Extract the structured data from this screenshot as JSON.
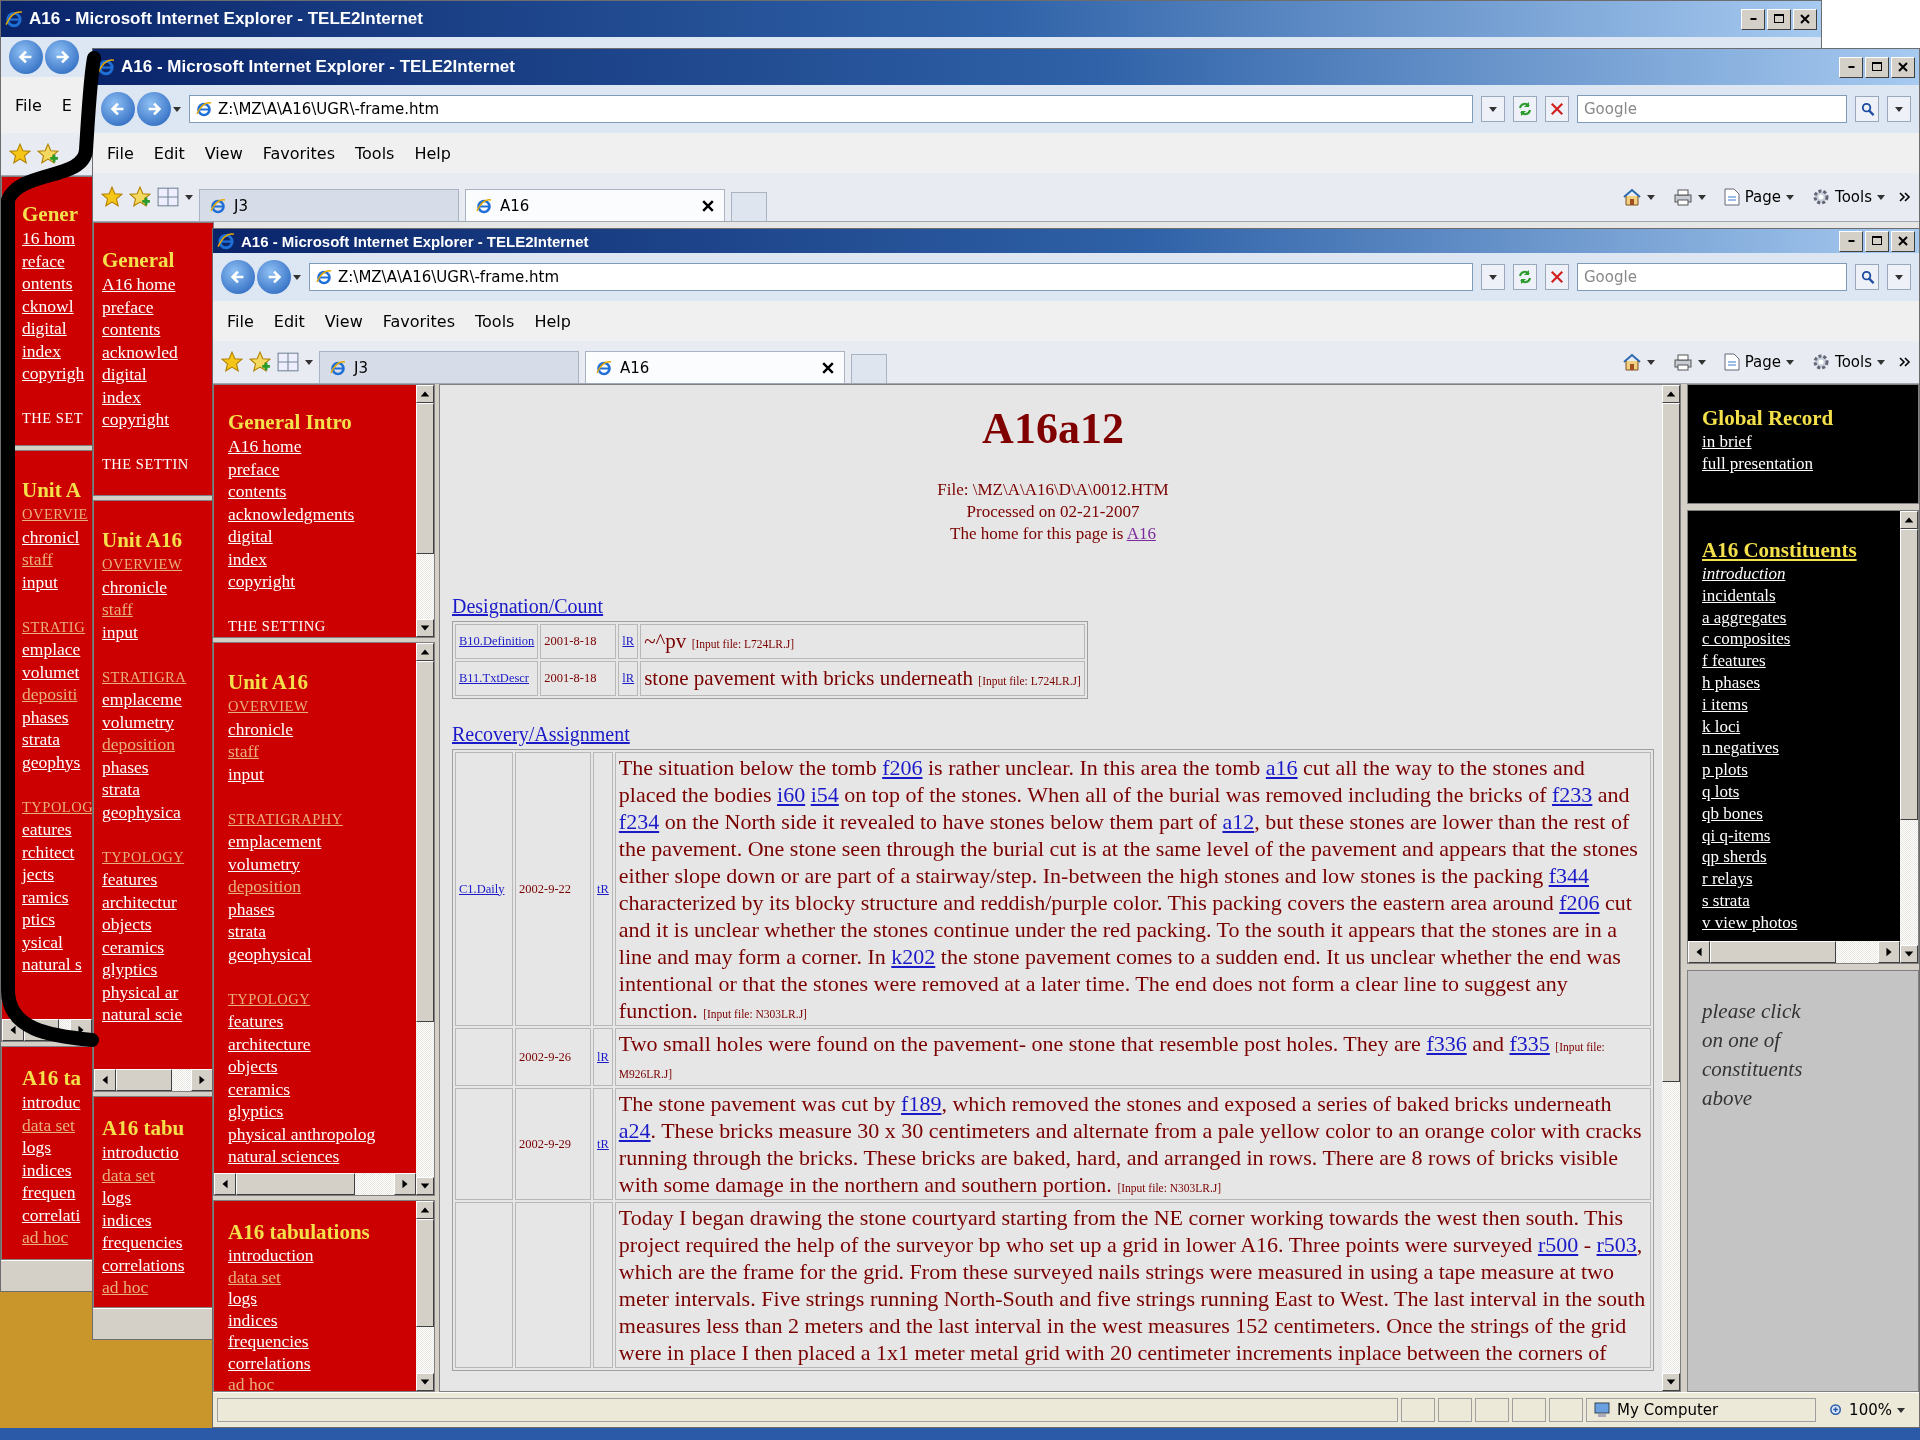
{
  "windows": [
    {
      "title": "A16 - Microsoft Internet Explorer - TELE2Internet",
      "menu": [
        "File",
        "E"
      ],
      "sidebar": [
        {
          "heading": "Gener",
          "items": [
            {
              "kind": "link",
              "text": "16 hom",
              "visited": false
            },
            {
              "kind": "link",
              "text": "reface",
              "visited": false
            },
            {
              "kind": "link",
              "text": "ontents",
              "visited": false
            },
            {
              "kind": "link",
              "text": "cknowl",
              "visited": false
            },
            {
              "kind": "link",
              "text": "digital",
              "visited": false
            },
            {
              "kind": "link",
              "text": "index",
              "visited": false
            },
            {
              "kind": "link",
              "text": "copyrigh",
              "visited": false
            },
            {
              "kind": "section",
              "text": "THE SET",
              "visited": false
            }
          ]
        },
        {
          "heading": "Unit A",
          "items": [
            {
              "kind": "section",
              "text": "OVERVIE",
              "visited": true
            },
            {
              "kind": "link",
              "text": "chronicl",
              "visited": false
            },
            {
              "kind": "link",
              "text": "staff",
              "visited": true
            },
            {
              "kind": "link",
              "text": "input",
              "visited": false
            },
            {
              "kind": "section",
              "text": "STRATIG",
              "visited": true
            },
            {
              "kind": "link",
              "text": "emplace",
              "visited": false
            },
            {
              "kind": "link",
              "text": "volumet",
              "visited": false
            },
            {
              "kind": "link",
              "text": "depositi",
              "visited": true
            },
            {
              "kind": "link",
              "text": "phases",
              "visited": false
            },
            {
              "kind": "link",
              "text": "strata",
              "visited": false
            },
            {
              "kind": "link",
              "text": "geophys",
              "visited": false
            },
            {
              "kind": "section",
              "text": "TYPOLOG",
              "visited": true
            },
            {
              "kind": "link",
              "text": "eatures",
              "visited": false
            },
            {
              "kind": "link",
              "text": "rchitect",
              "visited": false
            },
            {
              "kind": "link",
              "text": "jects",
              "visited": false
            },
            {
              "kind": "link",
              "text": "ramics",
              "visited": false
            },
            {
              "kind": "link",
              "text": "ptics",
              "visited": false
            },
            {
              "kind": "link",
              "text": "ysical",
              "visited": false
            },
            {
              "kind": "link",
              "text": "natural s",
              "visited": false
            }
          ]
        },
        {
          "heading": "A16 ta",
          "items": [
            {
              "kind": "link",
              "text": "introduc",
              "visited": false
            },
            {
              "kind": "link",
              "text": "data set",
              "visited": true
            },
            {
              "kind": "link",
              "text": "logs",
              "visited": false
            },
            {
              "kind": "link",
              "text": "indices",
              "visited": false
            },
            {
              "kind": "link",
              "text": "frequen",
              "visited": false
            },
            {
              "kind": "link",
              "text": "correlati",
              "visited": false
            },
            {
              "kind": "link",
              "text": "ad hoc",
              "visited": true
            }
          ]
        }
      ]
    },
    {
      "title": "A16 - Microsoft Internet Explorer - TELE2Internet",
      "address": "Z:\\MZ\\A\\A16\\UGR\\-frame.htm",
      "search_placeholder": "Google",
      "menu": [
        "File",
        "Edit",
        "View",
        "Favorites",
        "Tools",
        "Help"
      ],
      "tabs": [
        {
          "label": "J3",
          "selected": false
        },
        {
          "label": "A16",
          "selected": true
        }
      ],
      "toolbar": [
        "Page",
        "Tools"
      ],
      "sidebar": [
        {
          "heading": "General",
          "items": [
            {
              "kind": "link",
              "text": "A16 home",
              "visited": false
            },
            {
              "kind": "link",
              "text": "preface",
              "visited": false
            },
            {
              "kind": "link",
              "text": "contents",
              "visited": false
            },
            {
              "kind": "link",
              "text": "acknowled",
              "visited": false
            },
            {
              "kind": "link",
              "text": "digital",
              "visited": false
            },
            {
              "kind": "link",
              "text": "index",
              "visited": false
            },
            {
              "kind": "link",
              "text": "copyright",
              "visited": false
            },
            {
              "kind": "section",
              "text": "THE SETTIN",
              "visited": false
            }
          ]
        },
        {
          "heading": "Unit A16",
          "items": [
            {
              "kind": "section",
              "text": "OVERVIEW",
              "visited": true
            },
            {
              "kind": "link",
              "text": "chronicle",
              "visited": false
            },
            {
              "kind": "link",
              "text": "staff",
              "visited": true
            },
            {
              "kind": "link",
              "text": "input",
              "visited": false
            },
            {
              "kind": "section",
              "text": "STRATIGRA",
              "visited": true
            },
            {
              "kind": "link",
              "text": "emplaceme",
              "visited": false
            },
            {
              "kind": "link",
              "text": "volumetry",
              "visited": false
            },
            {
              "kind": "link",
              "text": "deposition",
              "visited": true
            },
            {
              "kind": "link",
              "text": "phases",
              "visited": false
            },
            {
              "kind": "link",
              "text": "strata",
              "visited": false
            },
            {
              "kind": "link",
              "text": "geophysica",
              "visited": false
            },
            {
              "kind": "section",
              "text": "TYPOLOGY",
              "visited": true
            },
            {
              "kind": "link",
              "text": "features",
              "visited": false
            },
            {
              "kind": "link",
              "text": "architectur",
              "visited": false
            },
            {
              "kind": "link",
              "text": "objects",
              "visited": false
            },
            {
              "kind": "link",
              "text": "ceramics",
              "visited": false
            },
            {
              "kind": "link",
              "text": "glyptics",
              "visited": false
            },
            {
              "kind": "link",
              "text": "physical ar",
              "visited": false
            },
            {
              "kind": "link",
              "text": "natural scie",
              "visited": false
            }
          ]
        },
        {
          "heading": "A16 tabu",
          "items": [
            {
              "kind": "link",
              "text": "introductio",
              "visited": false
            },
            {
              "kind": "link",
              "text": "data set",
              "visited": true
            },
            {
              "kind": "link",
              "text": "logs",
              "visited": false
            },
            {
              "kind": "link",
              "text": "indices",
              "visited": false
            },
            {
              "kind": "link",
              "text": "frequencies",
              "visited": false
            },
            {
              "kind": "link",
              "text": "correlations",
              "visited": false
            },
            {
              "kind": "link",
              "text": "ad hoc",
              "visited": true
            }
          ]
        }
      ]
    },
    {
      "title": "A16 - Microsoft Internet Explorer - TELE2Internet",
      "address": "Z:\\MZ\\A\\A16\\UGR\\-frame.htm",
      "search_placeholder": "Google",
      "menu": [
        "File",
        "Edit",
        "View",
        "Favorites",
        "Tools",
        "Help"
      ],
      "tabs": [
        {
          "label": "J3",
          "selected": false
        },
        {
          "label": "A16",
          "selected": true
        }
      ],
      "toolbar": [
        "Page",
        "Tools"
      ],
      "sidebar": [
        {
          "heading": "General Intro",
          "items": [
            {
              "kind": "link",
              "text": "A16 home",
              "visited": false
            },
            {
              "kind": "link",
              "text": "preface",
              "visited": false
            },
            {
              "kind": "link",
              "text": "contents",
              "visited": false
            },
            {
              "kind": "link",
              "text": "acknowledgments",
              "visited": false
            },
            {
              "kind": "link",
              "text": "digital",
              "visited": false
            },
            {
              "kind": "link",
              "text": "index",
              "visited": false
            },
            {
              "kind": "link",
              "text": "copyright",
              "visited": false
            },
            {
              "kind": "section",
              "text": "THE SETTING",
              "visited": false
            }
          ]
        },
        {
          "heading": "Unit A16",
          "items": [
            {
              "kind": "section",
              "text": "OVERVIEW",
              "visited": true
            },
            {
              "kind": "link",
              "text": "chronicle",
              "visited": false
            },
            {
              "kind": "link",
              "text": "staff",
              "visited": true
            },
            {
              "kind": "link",
              "text": "input",
              "visited": false
            },
            {
              "kind": "section",
              "text": "STRATIGRAPHY",
              "visited": true
            },
            {
              "kind": "link",
              "text": "emplacement",
              "visited": false
            },
            {
              "kind": "link",
              "text": "volumetry",
              "visited": false
            },
            {
              "kind": "link",
              "text": "deposition",
              "visited": true
            },
            {
              "kind": "link",
              "text": "phases",
              "visited": false
            },
            {
              "kind": "link",
              "text": "strata",
              "visited": false
            },
            {
              "kind": "link",
              "text": "geophysical",
              "visited": false
            },
            {
              "kind": "section",
              "text": "TYPOLOGY",
              "visited": true
            },
            {
              "kind": "link",
              "text": "features",
              "visited": false
            },
            {
              "kind": "link",
              "text": "architecture",
              "visited": false
            },
            {
              "kind": "link",
              "text": "objects",
              "visited": false
            },
            {
              "kind": "link",
              "text": "ceramics",
              "visited": false
            },
            {
              "kind": "link",
              "text": "glyptics",
              "visited": false
            },
            {
              "kind": "link",
              "text": "physical anthropolog",
              "visited": false
            },
            {
              "kind": "link",
              "text": "natural sciences",
              "visited": false
            }
          ]
        },
        {
          "heading": "A16 tabulations",
          "items": [
            {
              "kind": "link",
              "text": "introduction",
              "visited": false
            },
            {
              "kind": "link",
              "text": "data set",
              "visited": true
            },
            {
              "kind": "link",
              "text": "logs",
              "visited": false
            },
            {
              "kind": "link",
              "text": "indices",
              "visited": false
            },
            {
              "kind": "link",
              "text": "frequencies",
              "visited": false
            },
            {
              "kind": "link",
              "text": "correlations",
              "visited": false
            },
            {
              "kind": "link",
              "text": "ad hoc",
              "visited": true
            }
          ]
        }
      ],
      "page": {
        "title": "A16a12",
        "file_line": "File: \\MZ\\A\\A16\\D\\A\\0012.HTM",
        "processed_line": "Processed on 02-21-2007",
        "home_prefix": "The home for this page is ",
        "home_link": "A16",
        "sections": [
          {
            "heading": "Designation/Count",
            "rows": [
              {
                "code": "B10.Definition",
                "date": "2001-8-18",
                "ref": "lR",
                "parts": [
                  {
                    "kind": "text",
                    "text": "~^pv "
                  },
                  {
                    "kind": "note",
                    "text": "[Input file: L724LR.J]"
                  }
                ]
              },
              {
                "code": "B11.TxtDescr",
                "date": "2001-8-18",
                "ref": "lR",
                "parts": [
                  {
                    "kind": "text",
                    "text": "stone pavement with bricks underneath "
                  },
                  {
                    "kind": "note",
                    "text": "[Input file: L724LR.J]"
                  }
                ]
              }
            ]
          },
          {
            "heading": "Recovery/Assignment",
            "rows": [
              {
                "code": "C1.Daily",
                "date": "2002-9-22",
                "ref": "tR",
                "parts": [
                  {
                    "kind": "text",
                    "text": "The situation below the tomb "
                  },
                  {
                    "kind": "link",
                    "text": "f206"
                  },
                  {
                    "kind": "text",
                    "text": " is rather unclear. In this area the tomb "
                  },
                  {
                    "kind": "link",
                    "text": "a16"
                  },
                  {
                    "kind": "text",
                    "text": " cut all the way to the stones and placed the bodies "
                  },
                  {
                    "kind": "link",
                    "text": "i60"
                  },
                  {
                    "kind": "link",
                    "text": "i54"
                  },
                  {
                    "kind": "text",
                    "text": " on top of the stones. When all of the burial was removed including the bricks of "
                  },
                  {
                    "kind": "link",
                    "text": "f233"
                  },
                  {
                    "kind": "text",
                    "text": " and "
                  },
                  {
                    "kind": "link",
                    "text": "f234"
                  },
                  {
                    "kind": "text",
                    "text": " on the North side it revealed to have stones below them part of "
                  },
                  {
                    "kind": "link",
                    "text": "a12"
                  },
                  {
                    "kind": "text",
                    "text": ", but these stones are lower than the rest of the pavement. One stone seen through the burial cut is at the same level of the pavement and appears that the stones either slope down or are part of a stairway/step. In-between the high stones and low stones is the packing "
                  },
                  {
                    "kind": "link",
                    "text": "f344"
                  },
                  {
                    "kind": "text",
                    "text": " characterized by its blocky structure and reddish/purple color. This packing covers the eastern area around "
                  },
                  {
                    "kind": "link",
                    "text": "f206"
                  },
                  {
                    "kind": "text",
                    "text": " cut and it is unclear whether the stones continue under the red packing. To the south it appears that the stones are in a line and may form a corner. In "
                  },
                  {
                    "kind": "link",
                    "text": "k202"
                  },
                  {
                    "kind": "text",
                    "text": " the stone pavement comes to a sudden end. It us unclear whether the end was intentional or that the stones were removed at a later time. The end does not form a clear line to suggest any function. "
                  },
                  {
                    "kind": "note",
                    "text": "[Input file: N303LR.J]"
                  }
                ]
              },
              {
                "date": "2002-9-26",
                "ref": "lR",
                "parts": [
                  {
                    "kind": "text",
                    "text": "Two small holes were found on the pavement- one stone that resemble post holes. They are "
                  },
                  {
                    "kind": "link",
                    "text": "f336"
                  },
                  {
                    "kind": "text",
                    "text": " and "
                  },
                  {
                    "kind": "link",
                    "text": "f335"
                  },
                  {
                    "kind": "note",
                    "text": "[Input file: M926LR.J]"
                  }
                ]
              },
              {
                "date": "2002-9-29",
                "ref": "tR",
                "parts": [
                  {
                    "kind": "text",
                    "text": "The stone pavement was cut by "
                  },
                  {
                    "kind": "link",
                    "text": "f189"
                  },
                  {
                    "kind": "text",
                    "text": ", which removed the stones and exposed a series of baked bricks underneath "
                  },
                  {
                    "kind": "link",
                    "text": "a24"
                  },
                  {
                    "kind": "text",
                    "text": ". These bricks measure 30 x 30 centimeters and alternate from a pale yellow color to an orange color with cracks running through the bricks. These bricks are baked, hard, and arranged in rows. There are 8 rows of bricks visible with some damage in the northern and southern portion. "
                  },
                  {
                    "kind": "note",
                    "text": "[Input file: N303LR.J]"
                  }
                ]
              },
              {
                "parts": [
                  {
                    "kind": "text",
                    "text": "Today I began drawing the stone courtyard starting from the NE corner working towards the west then south. This project required the help of the surveyor bp who set up a grid in lower A16. Three points were surveyed "
                  },
                  {
                    "kind": "link",
                    "text": "r500"
                  },
                  {
                    "kind": "text",
                    "text": " - "
                  },
                  {
                    "kind": "link",
                    "text": "r503"
                  },
                  {
                    "kind": "text",
                    "text": ", which are the frame for the grid. From these surveyed nails strings were measured in using a tape measure at two meter intervals. Five strings running North-South and five strings running East to West. The last interval in the south measures less than 2 meters and the last interval in the west measures 152 centimeters. Once the strings of the grid were in place I then placed a 1x1 meter metal grid with 20 centimeter increments inplace between the corners of"
                  }
                ]
              }
            ]
          }
        ]
      },
      "right_frame": {
        "global_heading": "Global Record",
        "global_links": [
          "in brief",
          "full presentation"
        ],
        "constituents_heading": "A16 Constituents",
        "constituents": [
          {
            "text": "introduction",
            "current": true
          },
          {
            "text": "incidentals",
            "current": false
          },
          {
            "text": "a aggregates",
            "current": false
          },
          {
            "text": "c composites",
            "current": false
          },
          {
            "text": "f features",
            "current": false
          },
          {
            "text": "h phases",
            "current": false
          },
          {
            "text": "i items",
            "current": false
          },
          {
            "text": "k loci",
            "current": false
          },
          {
            "text": "n negatives",
            "current": false
          },
          {
            "text": "p plots",
            "current": false
          },
          {
            "text": "q lots",
            "current": false
          },
          {
            "text": "qb bones",
            "current": false
          },
          {
            "text": "qi q-items",
            "current": false
          },
          {
            "text": "qp sherds",
            "current": false
          },
          {
            "text": "r relays",
            "current": false
          },
          {
            "text": "s strata",
            "current": false
          },
          {
            "text": "v view photos",
            "current": false
          }
        ],
        "hint": "please click on one of constituents above"
      },
      "status": {
        "zone": "My Computer",
        "zoom": "100%"
      }
    }
  ]
}
